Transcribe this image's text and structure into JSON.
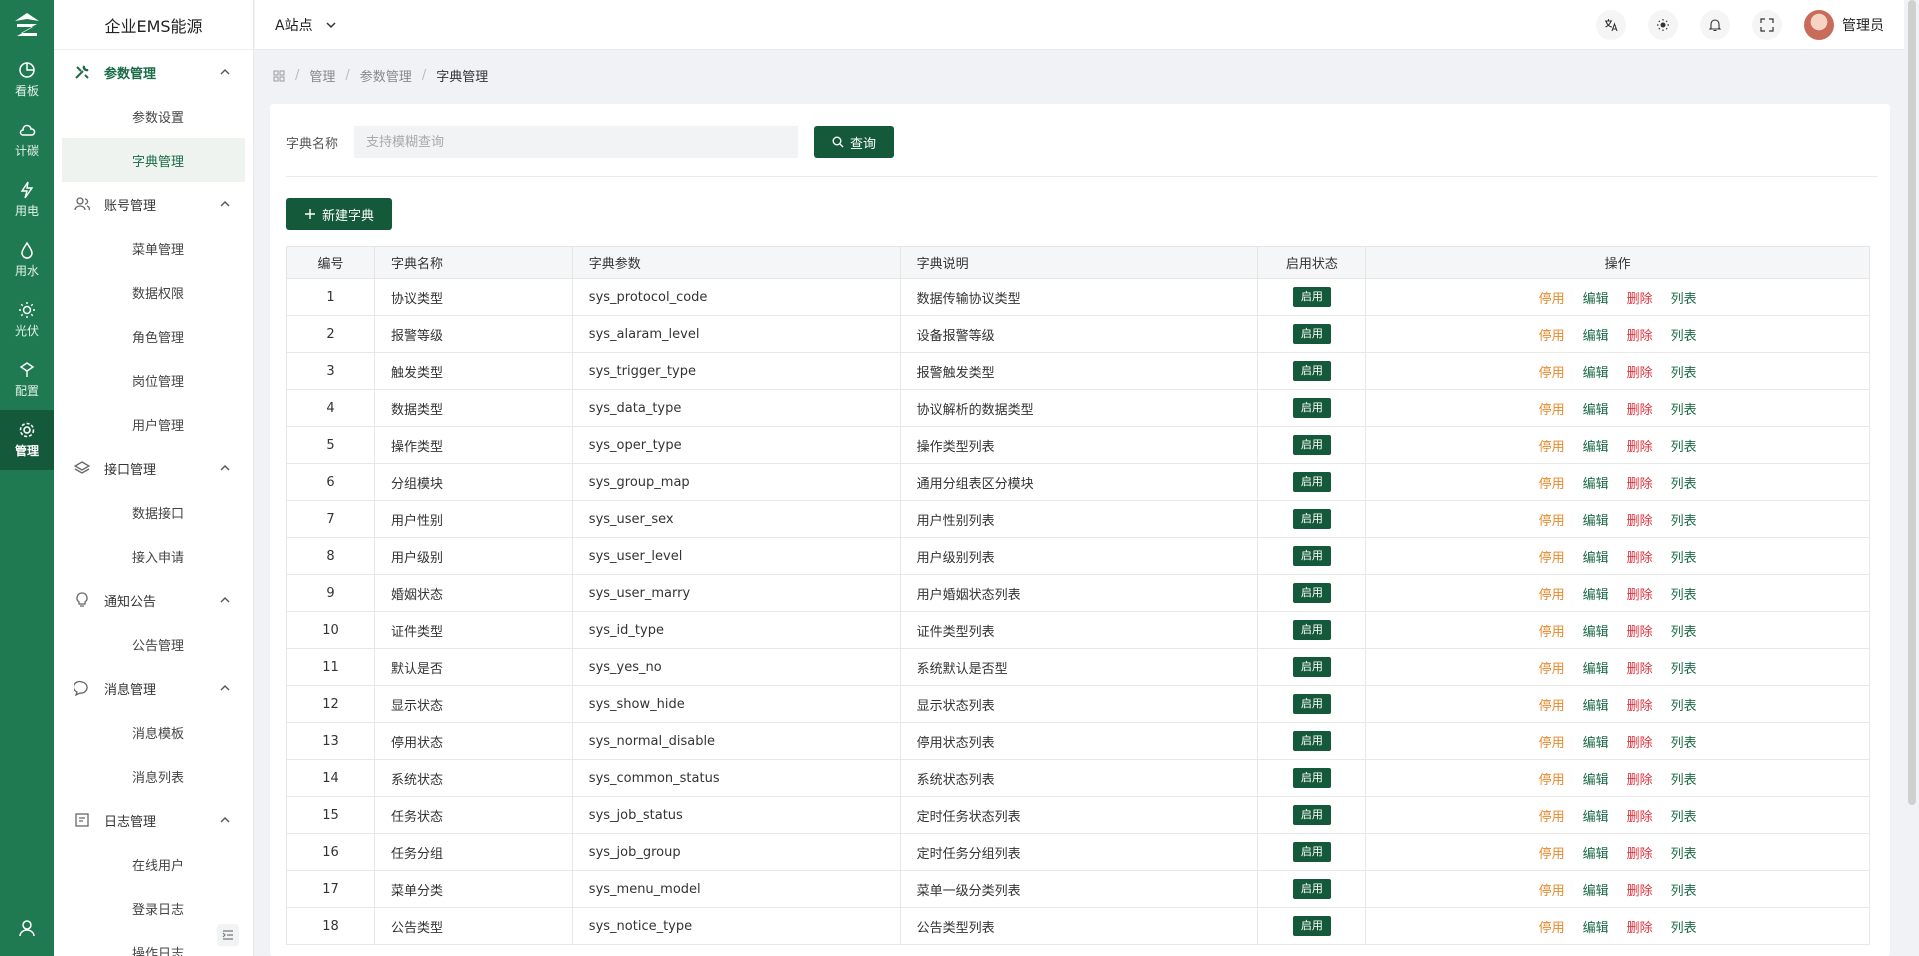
{
  "rail": {
    "items": [
      {
        "label": "看板"
      },
      {
        "label": "计碳"
      },
      {
        "label": "用电"
      },
      {
        "label": "用水"
      },
      {
        "label": "光伏"
      },
      {
        "label": "配置"
      },
      {
        "label": "管理"
      }
    ]
  },
  "sidebar": {
    "brand": "企业EMS能源",
    "groups": [
      {
        "label": "参数管理",
        "subs": [
          "参数设置",
          "字典管理"
        ]
      },
      {
        "label": "账号管理",
        "subs": [
          "菜单管理",
          "数据权限",
          "角色管理",
          "岗位管理",
          "用户管理"
        ]
      },
      {
        "label": "接口管理",
        "subs": [
          "数据接口",
          "接入申请"
        ]
      },
      {
        "label": "通知公告",
        "subs": [
          "公告管理"
        ]
      },
      {
        "label": "消息管理",
        "subs": [
          "消息模板",
          "消息列表"
        ]
      },
      {
        "label": "日志管理",
        "subs": [
          "在线用户",
          "登录日志",
          "操作日志"
        ]
      }
    ]
  },
  "topbar": {
    "site": "A站点",
    "user": "管理员"
  },
  "breadcrumb": {
    "items": [
      "管理",
      "参数管理",
      "字典管理"
    ]
  },
  "search": {
    "label": "字典名称",
    "placeholder": "支持模糊查询",
    "button": "查询"
  },
  "add_button": "新建字典",
  "table": {
    "headers": [
      "编号",
      "字典名称",
      "字典参数",
      "字典说明",
      "启用状态",
      "操作"
    ],
    "status_label": "启用",
    "actions": [
      "停用",
      "编辑",
      "删除",
      "列表"
    ],
    "rows": [
      {
        "no": "1",
        "name": "协议类型",
        "param": "sys_protocol_code",
        "desc": "数据传输协议类型"
      },
      {
        "no": "2",
        "name": "报警等级",
        "param": "sys_alaram_level",
        "desc": "设备报警等级"
      },
      {
        "no": "3",
        "name": "触发类型",
        "param": "sys_trigger_type",
        "desc": "报警触发类型"
      },
      {
        "no": "4",
        "name": "数据类型",
        "param": "sys_data_type",
        "desc": "协议解析的数据类型"
      },
      {
        "no": "5",
        "name": "操作类型",
        "param": "sys_oper_type",
        "desc": "操作类型列表"
      },
      {
        "no": "6",
        "name": "分组模块",
        "param": "sys_group_map",
        "desc": "通用分组表区分模块"
      },
      {
        "no": "7",
        "name": "用户性别",
        "param": "sys_user_sex",
        "desc": "用户性别列表"
      },
      {
        "no": "8",
        "name": "用户级别",
        "param": "sys_user_level",
        "desc": "用户级别列表"
      },
      {
        "no": "9",
        "name": "婚姻状态",
        "param": "sys_user_marry",
        "desc": "用户婚姻状态列表"
      },
      {
        "no": "10",
        "name": "证件类型",
        "param": "sys_id_type",
        "desc": "证件类型列表"
      },
      {
        "no": "11",
        "name": "默认是否",
        "param": "sys_yes_no",
        "desc": "系统默认是否型"
      },
      {
        "no": "12",
        "name": "显示状态",
        "param": "sys_show_hide",
        "desc": "显示状态列表"
      },
      {
        "no": "13",
        "name": "停用状态",
        "param": "sys_normal_disable",
        "desc": "停用状态列表"
      },
      {
        "no": "14",
        "name": "系统状态",
        "param": "sys_common_status",
        "desc": "系统状态列表"
      },
      {
        "no": "15",
        "name": "任务状态",
        "param": "sys_job_status",
        "desc": "定时任务状态列表"
      },
      {
        "no": "16",
        "name": "任务分组",
        "param": "sys_job_group",
        "desc": "定时任务分组列表"
      },
      {
        "no": "17",
        "name": "菜单分类",
        "param": "sys_menu_model",
        "desc": "菜单一级分类列表"
      },
      {
        "no": "18",
        "name": "公告类型",
        "param": "sys_notice_type",
        "desc": "公告类型列表"
      }
    ]
  },
  "colors": {
    "rail_bg": "#1f7a52",
    "primary": "#15593b",
    "stop": "#e8892b",
    "delete": "#e0313c"
  }
}
